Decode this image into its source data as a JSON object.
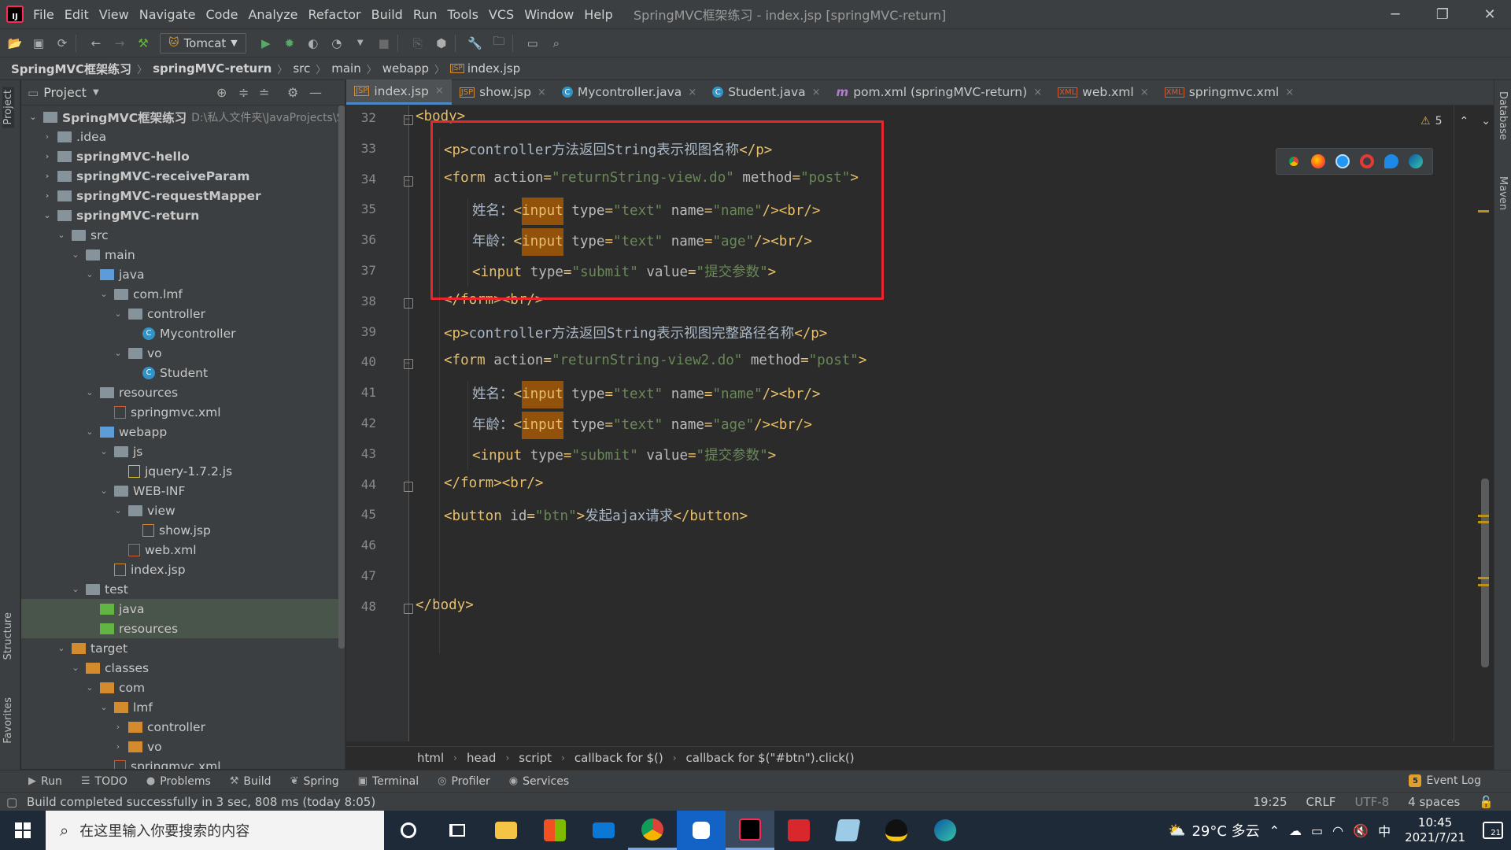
{
  "window": {
    "title": "SpringMVC框架练习 - index.jsp [springMVC-return]",
    "menu": [
      "File",
      "Edit",
      "View",
      "Navigate",
      "Code",
      "Analyze",
      "Refactor",
      "Build",
      "Run",
      "Tools",
      "VCS",
      "Window",
      "Help"
    ],
    "minimize_icon": "minimize-icon",
    "restore_icon": "restore-icon",
    "close_icon": "close-icon"
  },
  "toolbar": {
    "run_config": "Tomcat"
  },
  "breadcrumb": [
    "SpringMVC框架练习",
    "springMVC-return",
    "src",
    "main",
    "webapp",
    "index.jsp"
  ],
  "left_stripe": {
    "project": "Project",
    "structure": "Structure",
    "favorites": "Favorites"
  },
  "right_stripe": {
    "database": "Database",
    "maven": "Maven"
  },
  "project_panel": {
    "title": "Project",
    "tree": [
      {
        "label": "SpringMVC框架练习",
        "path": "D:\\私人文件夹\\JavaProjects\\S",
        "depth": 0,
        "open": true,
        "icon": "folder-module",
        "bold": true
      },
      {
        "label": ".idea",
        "depth": 1,
        "open": false,
        "icon": "folder"
      },
      {
        "label": "springMVC-hello",
        "depth": 1,
        "open": false,
        "icon": "folder-module",
        "bold": true
      },
      {
        "label": "springMVC-receiveParam",
        "depth": 1,
        "open": false,
        "icon": "folder-module",
        "bold": true
      },
      {
        "label": "springMVC-requestMapper",
        "depth": 1,
        "open": false,
        "icon": "folder-module",
        "bold": true
      },
      {
        "label": "springMVC-return",
        "depth": 1,
        "open": true,
        "icon": "folder-module",
        "bold": true
      },
      {
        "label": "src",
        "depth": 2,
        "open": true,
        "icon": "folder"
      },
      {
        "label": "main",
        "depth": 3,
        "open": true,
        "icon": "folder"
      },
      {
        "label": "java",
        "depth": 4,
        "open": true,
        "icon": "folder-src"
      },
      {
        "label": "com.lmf",
        "depth": 5,
        "open": true,
        "icon": "folder"
      },
      {
        "label": "controller",
        "depth": 6,
        "open": true,
        "icon": "folder"
      },
      {
        "label": "Mycontroller",
        "depth": 7,
        "icon": "class"
      },
      {
        "label": "vo",
        "depth": 6,
        "open": true,
        "icon": "folder"
      },
      {
        "label": "Student",
        "depth": 7,
        "icon": "class"
      },
      {
        "label": "resources",
        "depth": 4,
        "open": true,
        "icon": "folder-res"
      },
      {
        "label": "springmvc.xml",
        "depth": 5,
        "icon": "xml"
      },
      {
        "label": "webapp",
        "depth": 4,
        "open": true,
        "icon": "folder-src"
      },
      {
        "label": "js",
        "depth": 5,
        "open": true,
        "icon": "folder"
      },
      {
        "label": "jquery-1.7.2.js",
        "depth": 6,
        "icon": "js"
      },
      {
        "label": "WEB-INF",
        "depth": 5,
        "open": true,
        "icon": "folder"
      },
      {
        "label": "view",
        "depth": 6,
        "open": true,
        "icon": "folder"
      },
      {
        "label": "show.jsp",
        "depth": 7,
        "icon": "jsp"
      },
      {
        "label": "web.xml",
        "depth": 6,
        "icon": "xml"
      },
      {
        "label": "index.jsp",
        "depth": 5,
        "icon": "jsp"
      },
      {
        "label": "test",
        "depth": 3,
        "open": true,
        "icon": "folder"
      },
      {
        "label": "java",
        "depth": 4,
        "icon": "folder-test",
        "highlight": true
      },
      {
        "label": "resources",
        "depth": 4,
        "icon": "folder-test",
        "highlight": true
      },
      {
        "label": "target",
        "depth": 2,
        "open": true,
        "icon": "folder-orange"
      },
      {
        "label": "classes",
        "depth": 3,
        "open": true,
        "icon": "folder-orange"
      },
      {
        "label": "com",
        "depth": 4,
        "open": true,
        "icon": "folder-orange"
      },
      {
        "label": "lmf",
        "depth": 5,
        "open": true,
        "icon": "folder-orange"
      },
      {
        "label": "controller",
        "depth": 6,
        "open": false,
        "icon": "folder-orange"
      },
      {
        "label": "vo",
        "depth": 6,
        "open": false,
        "icon": "folder-orange"
      },
      {
        "label": "springmvc.xml",
        "depth": 5,
        "icon": "xml"
      }
    ]
  },
  "editor_tabs": [
    {
      "label": "index.jsp",
      "icon": "jsp",
      "active": true
    },
    {
      "label": "show.jsp",
      "icon": "jsp"
    },
    {
      "label": "Mycontroller.java",
      "icon": "class"
    },
    {
      "label": "Student.java",
      "icon": "class"
    },
    {
      "label": "pom.xml (springMVC-return)",
      "icon": "maven"
    },
    {
      "label": "web.xml",
      "icon": "xml"
    },
    {
      "label": "springmvc.xml",
      "icon": "xml"
    }
  ],
  "editor": {
    "warning_count": "5",
    "lines": [
      {
        "no": "32",
        "fold": "open",
        "indent": 0,
        "tokens": [
          [
            "tg",
            "<body>"
          ]
        ]
      },
      {
        "no": "33",
        "indent": 1,
        "tokens": [
          [
            "tg",
            "<p>"
          ],
          [
            "tx",
            "controller方法返回String表示视图名称"
          ],
          [
            "tg",
            "</p>"
          ]
        ]
      },
      {
        "no": "34",
        "fold": "open",
        "indent": 1,
        "tokens": [
          [
            "tg",
            "<form "
          ],
          [
            "at",
            "action"
          ],
          [
            "tg",
            "="
          ],
          [
            "av",
            "\"returnString-view.do\""
          ],
          [
            "tg",
            " "
          ],
          [
            "at",
            "method"
          ],
          [
            "tg",
            "="
          ],
          [
            "av",
            "\"post\""
          ],
          [
            "tg",
            ">"
          ]
        ]
      },
      {
        "no": "35",
        "indent": 2,
        "tokens": [
          [
            "tx",
            "姓名："
          ],
          [
            "tg",
            "<"
          ],
          [
            "hl",
            "input"
          ],
          [
            "tg",
            " "
          ],
          [
            "at",
            "type"
          ],
          [
            "tg",
            "="
          ],
          [
            "av",
            "\"text\""
          ],
          [
            "tg",
            " "
          ],
          [
            "at",
            "name"
          ],
          [
            "tg",
            "="
          ],
          [
            "av",
            "\"name\""
          ],
          [
            "tg",
            "/><br/>"
          ]
        ]
      },
      {
        "no": "36",
        "indent": 2,
        "tokens": [
          [
            "tx",
            "年龄："
          ],
          [
            "tg",
            "<"
          ],
          [
            "hl",
            "input"
          ],
          [
            "tg",
            " "
          ],
          [
            "at",
            "type"
          ],
          [
            "tg",
            "="
          ],
          [
            "av",
            "\"text\""
          ],
          [
            "tg",
            " "
          ],
          [
            "at",
            "name"
          ],
          [
            "tg",
            "="
          ],
          [
            "av",
            "\"age\""
          ],
          [
            "tg",
            "/><br/>"
          ]
        ]
      },
      {
        "no": "37",
        "indent": 2,
        "tokens": [
          [
            "tg",
            "<input "
          ],
          [
            "at",
            "type"
          ],
          [
            "tg",
            "="
          ],
          [
            "av",
            "\"submit\""
          ],
          [
            "tg",
            " "
          ],
          [
            "at",
            "value"
          ],
          [
            "tg",
            "="
          ],
          [
            "av",
            "\"提交参数\""
          ],
          [
            "tg",
            ">"
          ]
        ]
      },
      {
        "no": "38",
        "fold": "close",
        "indent": 1,
        "tokens": [
          [
            "tg",
            "</form><br/>"
          ]
        ]
      },
      {
        "no": "39",
        "indent": 1,
        "tokens": [
          [
            "tg",
            "<p>"
          ],
          [
            "tx",
            "controller方法返回String表示视图完整路径名称"
          ],
          [
            "tg",
            "</p>"
          ]
        ]
      },
      {
        "no": "40",
        "fold": "open",
        "indent": 1,
        "tokens": [
          [
            "tg",
            "<form "
          ],
          [
            "at",
            "action"
          ],
          [
            "tg",
            "="
          ],
          [
            "av",
            "\"returnString-view2.do\""
          ],
          [
            "tg",
            " "
          ],
          [
            "at",
            "method"
          ],
          [
            "tg",
            "="
          ],
          [
            "av",
            "\"post\""
          ],
          [
            "tg",
            ">"
          ]
        ]
      },
      {
        "no": "41",
        "indent": 2,
        "tokens": [
          [
            "tx",
            "姓名："
          ],
          [
            "tg",
            "<"
          ],
          [
            "hl",
            "input"
          ],
          [
            "tg",
            " "
          ],
          [
            "at",
            "type"
          ],
          [
            "tg",
            "="
          ],
          [
            "av",
            "\"text\""
          ],
          [
            "tg",
            " "
          ],
          [
            "at",
            "name"
          ],
          [
            "tg",
            "="
          ],
          [
            "av",
            "\"name\""
          ],
          [
            "tg",
            "/><br/>"
          ]
        ]
      },
      {
        "no": "42",
        "indent": 2,
        "tokens": [
          [
            "tx",
            "年龄："
          ],
          [
            "tg",
            "<"
          ],
          [
            "hl",
            "input"
          ],
          [
            "tg",
            " "
          ],
          [
            "at",
            "type"
          ],
          [
            "tg",
            "="
          ],
          [
            "av",
            "\"text\""
          ],
          [
            "tg",
            " "
          ],
          [
            "at",
            "name"
          ],
          [
            "tg",
            "="
          ],
          [
            "av",
            "\"age\""
          ],
          [
            "tg",
            "/><br/>"
          ]
        ]
      },
      {
        "no": "43",
        "indent": 2,
        "tokens": [
          [
            "tg",
            "<input "
          ],
          [
            "at",
            "type"
          ],
          [
            "tg",
            "="
          ],
          [
            "av",
            "\"submit\""
          ],
          [
            "tg",
            " "
          ],
          [
            "at",
            "value"
          ],
          [
            "tg",
            "="
          ],
          [
            "av",
            "\"提交参数\""
          ],
          [
            "tg",
            ">"
          ]
        ]
      },
      {
        "no": "44",
        "fold": "close",
        "indent": 1,
        "tokens": [
          [
            "tg",
            "</form><br/>"
          ]
        ]
      },
      {
        "no": "45",
        "indent": 1,
        "tokens": [
          [
            "tg",
            "<button "
          ],
          [
            "at",
            "id"
          ],
          [
            "tg",
            "="
          ],
          [
            "av",
            "\"btn\""
          ],
          [
            "tg",
            ">"
          ],
          [
            "tx",
            "发起ajax请求"
          ],
          [
            "tg",
            "</button>"
          ]
        ]
      },
      {
        "no": "46",
        "indent": 0,
        "tokens": []
      },
      {
        "no": "47",
        "indent": 0,
        "tokens": []
      },
      {
        "no": "48",
        "fold": "close",
        "indent": 0,
        "tokens": [
          [
            "tg",
            "</body>"
          ]
        ]
      }
    ]
  },
  "code_breadcrumb": [
    "html",
    "head",
    "script",
    "callback for $()",
    "callback for $(\"#btn\").click()"
  ],
  "bottom_tools": [
    {
      "label": "Run",
      "icon": "play-icon"
    },
    {
      "label": "TODO",
      "icon": "list-icon"
    },
    {
      "label": "Problems",
      "icon": "info-icon"
    },
    {
      "label": "Build",
      "icon": "hammer-icon"
    },
    {
      "label": "Spring",
      "icon": "leaf-icon"
    },
    {
      "label": "Terminal",
      "icon": "terminal-icon"
    },
    {
      "label": "Profiler",
      "icon": "profiler-icon"
    },
    {
      "label": "Services",
      "icon": "services-icon"
    }
  ],
  "event_log": {
    "label": "Event Log",
    "count": "5"
  },
  "status": {
    "message": "Build completed successfully in 3 sec, 808 ms (today 8:05)",
    "position": "19:25",
    "line_sep": "CRLF",
    "encoding": "UTF-8",
    "indent": "4 spaces"
  },
  "taskbar": {
    "search_placeholder": "在这里输入你要搜索的内容",
    "weather": "29°C 多云",
    "ime": "中",
    "time": "10:45",
    "date": "2021/7/21",
    "notifications": "21"
  },
  "colors": {
    "highlight_box": "#e8262d",
    "accent": "#4a88c7"
  }
}
